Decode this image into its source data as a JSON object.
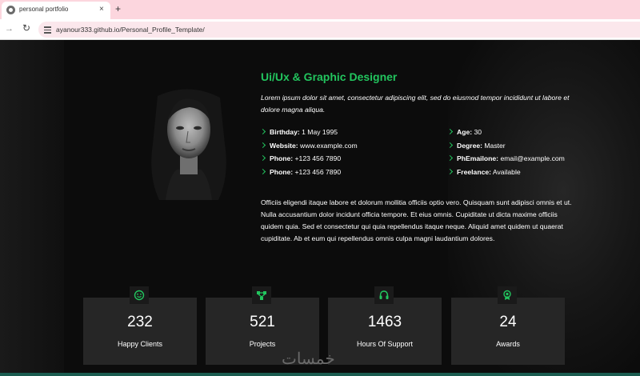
{
  "browser": {
    "tab_title": "personal portfolio",
    "tab_close": "×",
    "new_tab": "+",
    "url": "ayanour333.github.io/Personal_Profile_Template/"
  },
  "profile": {
    "heading": "Ui/Ux & Graphic Designer",
    "lead": "Lorem ipsum dolor sit amet, consectetur adipiscing elit, sed do eiusmod tempor incididunt ut labore et dolore magna aliqua.",
    "info_left": [
      {
        "label": "Birthday:",
        "value": "1 May 1995"
      },
      {
        "label": "Website:",
        "value": "www.example.com"
      },
      {
        "label": "Phone:",
        "value": "+123 456 7890"
      },
      {
        "label": "Phone:",
        "value": "+123 456 7890"
      }
    ],
    "info_right": [
      {
        "label": "Age:",
        "value": "30"
      },
      {
        "label": "Degree:",
        "value": "Master"
      },
      {
        "label": "PhEmailone:",
        "value": "email@example.com"
      },
      {
        "label": "Freelance:",
        "value": "Available"
      }
    ],
    "description": "Officiis eligendi itaque labore et dolorum mollitia officiis optio vero. Quisquam sunt adipisci omnis et ut. Nulla accusantium dolor incidunt officia tempore. Et eius omnis. Cupiditate ut dicta maxime officiis quidem quia. Sed et consectetur qui quia repellendus itaque neque. Aliquid amet quidem ut quaerat cupiditate. Ab et eum qui repellendus omnis culpa magni laudantium dolores."
  },
  "stats": [
    {
      "number": "232",
      "label": "Happy Clients",
      "icon": "smiley-icon"
    },
    {
      "number": "521",
      "label": "Projects",
      "icon": "diagram-icon"
    },
    {
      "number": "1463",
      "label": "Hours Of Support",
      "icon": "headset-icon"
    },
    {
      "number": "24",
      "label": "Awards",
      "icon": "award-icon"
    }
  ],
  "watermark": "خمسات",
  "colors": {
    "accent": "#22c55e",
    "card": "#262626",
    "background": "#0c0c0c"
  }
}
